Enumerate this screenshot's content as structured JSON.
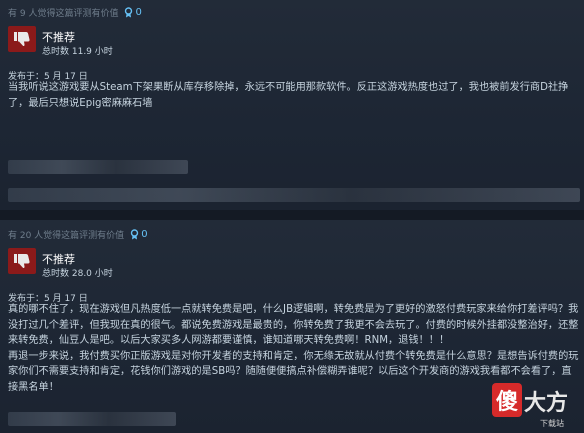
{
  "reviews": [
    {
      "helpful_text": "有 9 人觉得这篇评测有价值",
      "helpful_count": "0",
      "verdict": "不推荐",
      "hours": "总时数 11.9 小时",
      "posted": "发布于：5 月 17 日",
      "body": "当我听说这游戏要从Steam下架果断从库存移除掉，永远不可能用那款软件。反正这游戏热度也过了，我也被前发行商D社挣了，最后只想说Epig密麻麻石墙"
    },
    {
      "helpful_text": "有 20 人觉得这篇评测有价值",
      "helpful_count": "0",
      "verdict": "不推荐",
      "hours": "总时数 28.0 小时",
      "posted": "发布于：5 月 17 日",
      "body": "真的哪不住了，现在游戏但凡热度低一点就转免费是吧，什么JB逻辑啊，转免费是为了更好的激怒付费玩家来给你打差评吗？我没打过几个差评，但我现在真的很气。都说免费游戏是最贵的，你转免费了我更不会去玩了。付费的时候外挂都没整治好，还整来转免费，仙豆人是吧。以后大家买多人网游都要谨慎，谁知道哪天转免费啊！RNM，退钱！！！\n再退一步来说，我付费买你正版游戏是对你开发者的支持和肯定，你无缘无故就从付费个转免费是什么意思？是想告诉付费的玩家你们不需要支持和肯定，花钱你们游戏的是SB吗？随随便便搞点补偿糊弄谁呢？以后这个开发商的游戏我看都不会看了，直接黑名单！"
    }
  ],
  "watermark": {
    "main": "傻",
    "rest": "大方",
    "small": "下载站"
  }
}
